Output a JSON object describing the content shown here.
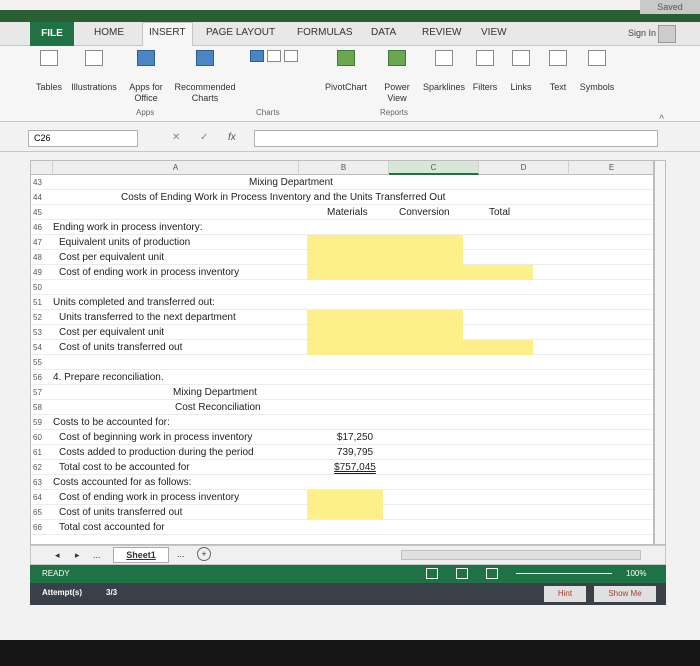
{
  "window": {
    "saved_label": "Saved"
  },
  "tabs": [
    "FILE",
    "HOME",
    "INSERT",
    "PAGE LAYOUT",
    "FORMULAS",
    "DATA",
    "REVIEW",
    "VIEW"
  ],
  "signin": "Sign In",
  "ribbon": {
    "tables": "Tables",
    "illustrations": "Illustrations",
    "apps_for": "Apps for",
    "office": "Office",
    "recommended": "Recommended",
    "charts": "Charts",
    "pivotchart": "PivotChart",
    "power": "Power",
    "view": "View",
    "sparklines": "Sparklines",
    "filters": "Filters",
    "links": "Links",
    "text": "Text",
    "symbols": "Symbols",
    "group_apps": "Apps",
    "group_charts": "Charts",
    "group_reports": "Reports"
  },
  "formula_bar": {
    "name_box": "C26",
    "fx": "fx",
    "cancel": "✕",
    "enter": "✓"
  },
  "columns": [
    "A",
    "B",
    "C",
    "D",
    "E"
  ],
  "rows": {
    "r43": {
      "num": "43"
    },
    "r44": {
      "num": "44"
    },
    "r45": {
      "num": "45"
    },
    "title1": "Mixing Department",
    "title2": "Costs of Ending Work in Process Inventory and the Units Transferred Out",
    "hdr_materials": "Materials",
    "hdr_conversion": "Conversion",
    "hdr_total": "Total",
    "r46": {
      "num": "46",
      "a": "Ending work in process inventory:"
    },
    "r47": {
      "num": "47",
      "a": "Equivalent units of production"
    },
    "r48": {
      "num": "48",
      "a": "Cost per equivalent unit"
    },
    "r49": {
      "num": "49",
      "a": "Cost of ending work in process inventory"
    },
    "r50": {
      "num": "50"
    },
    "r51": {
      "num": "51",
      "a": "Units completed and transferred out:"
    },
    "r52": {
      "num": "52",
      "a": "Units transferred to the next department"
    },
    "r53": {
      "num": "53",
      "a": "Cost per equivalent unit"
    },
    "r54": {
      "num": "54",
      "a": "Cost of units transferred out"
    },
    "r55": {
      "num": "55"
    },
    "r56": {
      "num": "56",
      "a": "4. Prepare reconciliation."
    },
    "r57": {
      "num": "57",
      "a": "Mixing Department"
    },
    "r58": {
      "num": "58",
      "a": "Cost Reconciliation"
    },
    "r59": {
      "num": "59",
      "a": "Costs to be accounted for:"
    },
    "r60": {
      "num": "60",
      "a": "Cost of beginning work in process inventory",
      "b": "$17,250"
    },
    "r61": {
      "num": "61",
      "a": "Costs added to production during the period",
      "b": "739,795"
    },
    "r62": {
      "num": "62",
      "a": "Total cost to be accounted for",
      "b": "$757,045"
    },
    "r63": {
      "num": "63",
      "a": "Costs accounted for as follows:"
    },
    "r64": {
      "num": "64",
      "a": "Cost of ending work in process inventory"
    },
    "r65": {
      "num": "65",
      "a": "Cost of units transferred out"
    },
    "r66": {
      "num": "66",
      "a": "Total cost accounted for"
    }
  },
  "sheet_tab": "Sheet1",
  "status": {
    "ready": "READY",
    "zoom": "100%"
  },
  "attempt": {
    "label": "Attempt(s)",
    "value": "3/3",
    "hint": "Hint",
    "show_me": "Show Me"
  },
  "colors": {
    "excel_green": "#1f7244",
    "highlight_yellow": "#fdf08a"
  }
}
